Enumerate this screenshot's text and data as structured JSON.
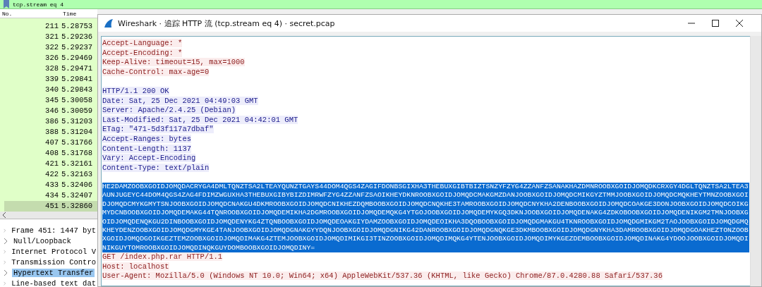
{
  "filter_bar": {
    "value": "tcp.stream eq 4"
  },
  "packet_list": {
    "columns": [
      "No.",
      "Time"
    ],
    "rows": [
      {
        "no": "211",
        "time": "5.28753",
        "selected": false
      },
      {
        "no": "321",
        "time": "5.29236",
        "selected": false
      },
      {
        "no": "322",
        "time": "5.29237",
        "selected": false
      },
      {
        "no": "326",
        "time": "5.29469",
        "selected": false
      },
      {
        "no": "328",
        "time": "5.29471",
        "selected": false
      },
      {
        "no": "339",
        "time": "5.29841",
        "selected": false
      },
      {
        "no": "340",
        "time": "5.29843",
        "selected": false
      },
      {
        "no": "345",
        "time": "5.30058",
        "selected": false
      },
      {
        "no": "346",
        "time": "5.30059",
        "selected": false
      },
      {
        "no": "386",
        "time": "5.31203",
        "selected": false
      },
      {
        "no": "388",
        "time": "5.31204",
        "selected": false
      },
      {
        "no": "407",
        "time": "5.31766",
        "selected": false
      },
      {
        "no": "408",
        "time": "5.31768",
        "selected": false
      },
      {
        "no": "421",
        "time": "5.32161",
        "selected": false
      },
      {
        "no": "422",
        "time": "5.32163",
        "selected": false
      },
      {
        "no": "433",
        "time": "5.32406",
        "selected": false
      },
      {
        "no": "434",
        "time": "5.32407",
        "selected": false
      },
      {
        "no": "451",
        "time": "5.32860",
        "selected": true
      }
    ]
  },
  "packet_details": [
    {
      "label": "Frame 451: 1447 byt",
      "selected": false
    },
    {
      "label": "Null/Loopback",
      "selected": false
    },
    {
      "label": "Internet Protocol V",
      "selected": false
    },
    {
      "label": "Transmission Contro",
      "selected": false
    },
    {
      "label": "Hypertext Transfer",
      "selected": true
    },
    {
      "label": "Line-based text dat",
      "selected": false
    }
  ],
  "dialog": {
    "title": "Wireshark · 追踪 HTTP 流 (tcp.stream eq 4) · secret.pcap",
    "blocks": [
      {
        "kind": "client",
        "gap_before": false,
        "selected": false,
        "lines": [
          "Accept-Language: *",
          "Accept-Encoding: *",
          "Keep-Alive: timeout=15, max=1000",
          "Cache-Control: max-age=0"
        ]
      },
      {
        "kind": "server",
        "gap_before": true,
        "selected": false,
        "lines": [
          "HTTP/1.1 200 OK",
          "Date: Sat, 25 Dec 2021 04:49:03 GMT",
          "Server: Apache/2.4.25 (Debian)",
          "Last-Modified: Sat, 25 Dec 2021 04:42:01 GMT",
          "ETag: \"471-5d3f117a7dbaf\"",
          "Accept-Ranges: bytes",
          "Content-Length: 1137",
          "Vary: Accept-Encoding",
          "Content-Type: text/plain"
        ]
      },
      {
        "kind": "server",
        "gap_before": true,
        "selected": true,
        "lines": [
          "HE2DAMZOOBXGOIDJOMQDACRYGA4DMLTQNZTSA2LTEAYQUNZTGAYS44DOM4QGS4ZAGIFDONBSGIXHA3THEBUXGIBTBIZTSNZYFZYG4ZZANFZSANAKHAZDMNROOBXGOIDJOMQDKCRXGY4DGLTQNZTSA2LTEA3AUNJUGEYC44DOM4QGS4ZAG4FDIMZWGUXHA3THEBUXGIBYBIZDIMRWFZYG4ZZANFZSAOIKHEYDKNROOBXGOIDJOMQDCMAKGMZDANJOOBXGOIDJOMQDCMIKGYZTMMJOOBXGOIDJOMQDCMQKHEYTMNZOOBXGOIDJOMQDCMYKGMYTSNJOOBXGOIDJOMQDCNAKGU4DKMROOBXGOIDJOMQDCNIKHEZDQMBOOBXGOIDJOMQDCNQKHE3TAMROOBXGOIDJOMQDCNYKHA2DENBOOBXGOIDJOMQDCOAKGE3DONJOOBXGOIDJOMQDCOIKGMYDCNBOOBXGOIDJOMQDEMAKG44TQNROOBXGOIDJOMQDEMIKHA2DGMROOBXGOIDJOMQDEMQKG4YTGOJOOBXGOIDJOMQDEMYKGQ3DKNJOOBXGOIDJOMQDENAKG4ZDKOBOOBXGOIDJOMQDENIKGM2TMNJOOBXGOIDJOMQDENQKGU2DINBOOBXGOIDJOMQDENYKG4ZTQNBOOBXGOIDJOMQDEOAKGIYDAMZOOBXGOIDJOMQDEOIKHA3DQOBOOBXGOIDJOMQDGMAKGU4TKNROOBXGOIDJOMQDGMIKGM2TAOJOOBXGOIDJOMQDGMQKHEYDENZOOBXGOIDJOMQDGMYKGE4TANJOOBXGOIDJOMQDGNAKGYYDQNJOOBXGOIDJOMQDGNIKG42DANROOBXGOIDJOMQDGNQKGE3DKMBOOBXGOIDJOMQDGNYKHA3DAMROOBXGOIDJOMQDGOAKHEZTONZOOBXGOIDJOMQDGOIKGEZTEMZOOBXGOIDJOMQDIMAKG4ZTEMJOOBXGOIDJOMQDIMIKGI3TINZOOBXGOIDJOMQDIMQKG4YTENJOOBXGOIDJOMQDIMYKGEZDEMBOOBXGOIDJOMQDINAKG4YDOOJOOBXGOIDJOMQDINIKGUYTOMROOBXGOIDJOMQDINQKGUYDOMBOOBXGOIDJOMQDINY="
        ]
      },
      {
        "kind": "client",
        "selected": false,
        "lines": [
          "GET /index.php.rar HTTP/1.1",
          "Host: localhost",
          "User-Agent: Mozilla/5.0 (Windows NT 10.0; Win64; x64) AppleWebKit/537.36 (KHTML, like Gecko) Chrome/87.0.4280.88 Safari/537.36"
        ]
      }
    ]
  }
}
